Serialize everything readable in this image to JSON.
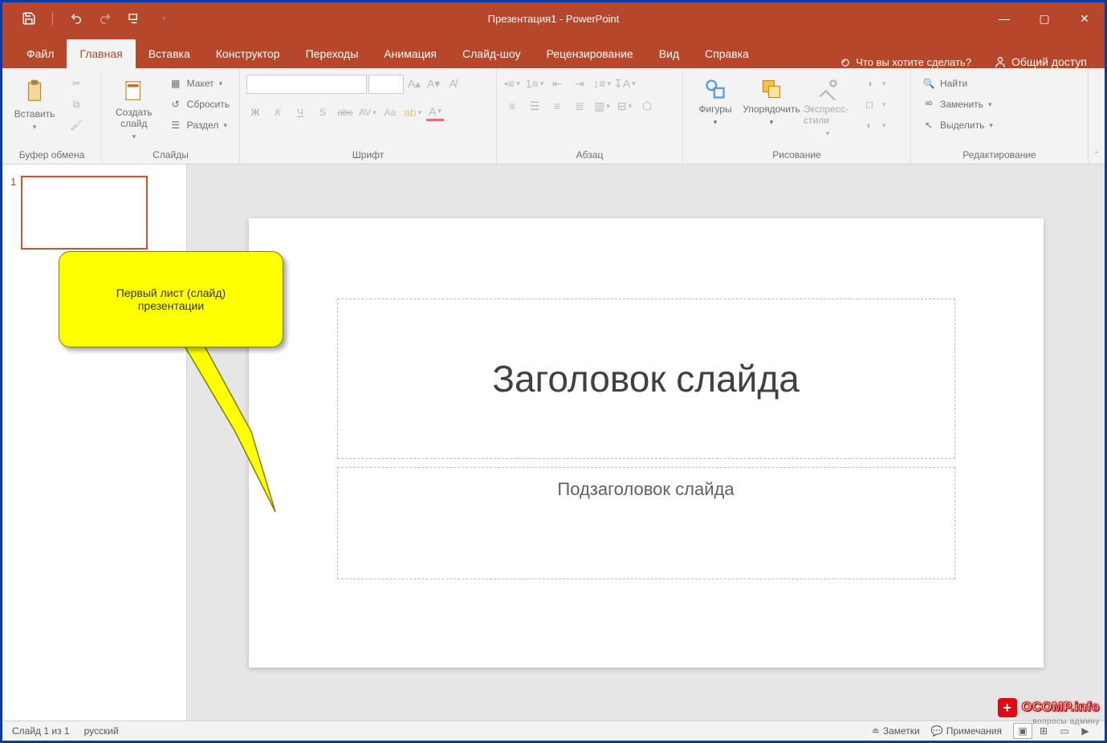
{
  "app": {
    "doc_name": "Презентация1",
    "app_name": "PowerPoint",
    "title_sep": " - "
  },
  "win": {
    "min": "—",
    "max": "▢",
    "close": "✕"
  },
  "tabs": {
    "file": "Файл",
    "home": "Главная",
    "insert": "Вставка",
    "design": "Конструктор",
    "transitions": "Переходы",
    "animations": "Анимация",
    "slideshow": "Слайд-шоу",
    "review": "Рецензирование",
    "view": "Вид",
    "help": "Справка"
  },
  "tellme": "Что вы хотите сделать?",
  "share": "Общий доступ",
  "ribbon": {
    "clipboard": {
      "label": "Буфер обмена",
      "paste": "Вставить"
    },
    "slides": {
      "label": "Слайды",
      "new": "Создать слайд",
      "layout": "Макет",
      "reset": "Сбросить",
      "section": "Раздел"
    },
    "font": {
      "label": "Шрифт"
    },
    "paragraph": {
      "label": "Абзац"
    },
    "drawing": {
      "label": "Рисование",
      "shapes": "Фигуры",
      "arrange": "Упорядочить",
      "quick": "Экспресс-стили"
    },
    "editing": {
      "label": "Редактирование",
      "find": "Найти",
      "replace": "Заменить",
      "select": "Выделить"
    }
  },
  "thumb": {
    "num": "1"
  },
  "callout": {
    "line1": "Первый лист (слайд)",
    "line2": "презентации"
  },
  "slide": {
    "title": "Заголовок слайда",
    "subtitle": "Подзаголовок слайда"
  },
  "status": {
    "slide_of": "Слайд 1 из 1",
    "lang": "русский",
    "notes": "Заметки",
    "comments": "Примечания"
  },
  "watermark": {
    "brand": "OCOMP.info",
    "sub": "вопросы админу"
  }
}
